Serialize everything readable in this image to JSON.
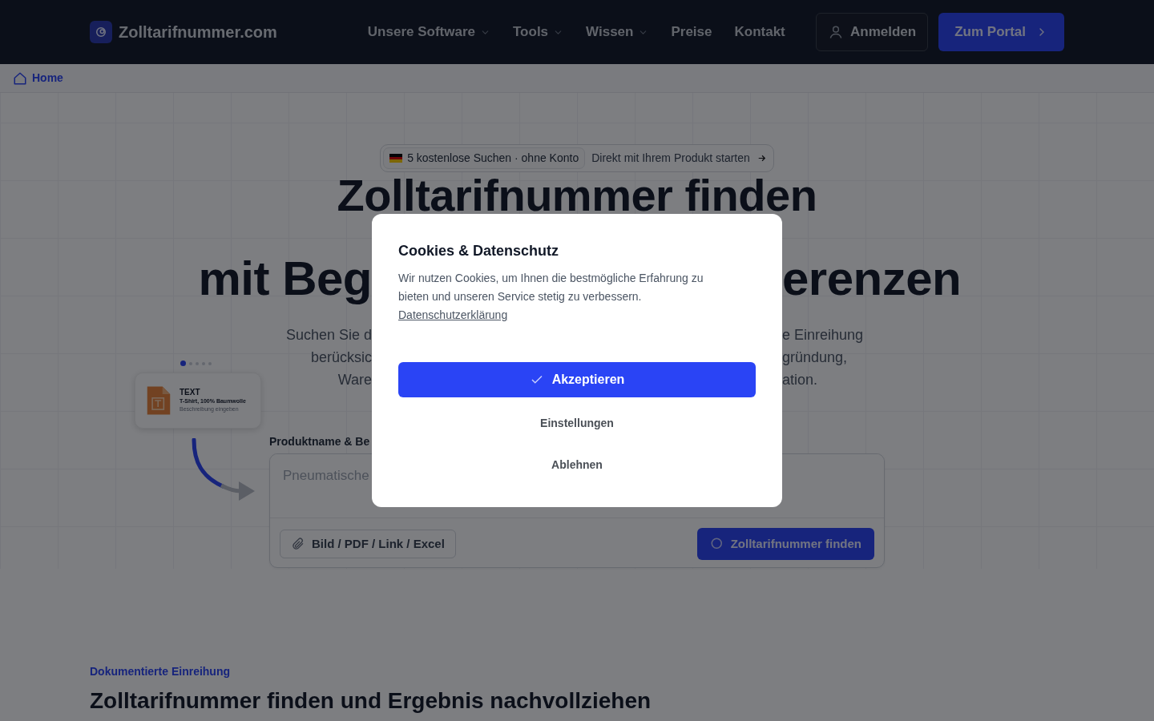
{
  "nav": {
    "brand": "Zolltarifnummer.com",
    "items": [
      {
        "label": "Unsere Software",
        "has_menu": true
      },
      {
        "label": "Tools",
        "has_menu": true
      },
      {
        "label": "Wissen",
        "has_menu": true
      },
      {
        "label": "Preise",
        "has_menu": false
      },
      {
        "label": "Kontakt",
        "has_menu": false
      }
    ],
    "login": "Anmelden",
    "portal": "Zum Portal"
  },
  "breadcrumb": {
    "label": "Home"
  },
  "hero": {
    "badge": {
      "tag": "5 kostenlose Suchen · ohne Konto",
      "link": "Direkt mit Ihrem Produkt starten"
    },
    "title_line_1": "Zolltarifnummer finden",
    "title_line_2": {
      "left": "mit Beg",
      "right": "erenzen"
    },
    "intro_lines": [
      {
        "left": "Suchen Sie d",
        "right": "e Einreihung"
      },
      {
        "left": "berücksic",
        "right": "gründung,"
      },
      {
        "left": "Ware",
        "right": "ation."
      }
    ]
  },
  "carousel": {
    "dots": [
      {
        "selected": true
      },
      {
        "selected": false
      },
      {
        "selected": false
      },
      {
        "selected": false
      },
      {
        "selected": false
      }
    ]
  },
  "example_card": {
    "tag": "TEXT",
    "title": "T-Shirt, 100% Baumwolle",
    "hint": "Beschreibung eingeben"
  },
  "search": {
    "label": "Produktname & Be",
    "placeholder": "Pneumatische",
    "upload_button": "Bild / PDF / Link / Excel",
    "submit_button": "Zolltarifnummer finden"
  },
  "section": {
    "eyebrow": "Dokumentierte Einreihung",
    "heading": "Zolltarifnummer finden und Ergebnis nachvollziehen"
  },
  "cookie_dialog": {
    "title": "Cookies & Datenschutz",
    "text": "Wir nutzen Cookies, um Ihnen die bestmögliche Erfahrung zu bieten und unseren Service stetig zu verbessern.",
    "link": "Datenschutzerklärung",
    "buttons": [
      {
        "label": "Akzeptieren",
        "kind": "primary"
      },
      {
        "label": "Einstellungen",
        "kind": "text"
      },
      {
        "label": "Ablehnen",
        "kind": "text"
      }
    ]
  }
}
